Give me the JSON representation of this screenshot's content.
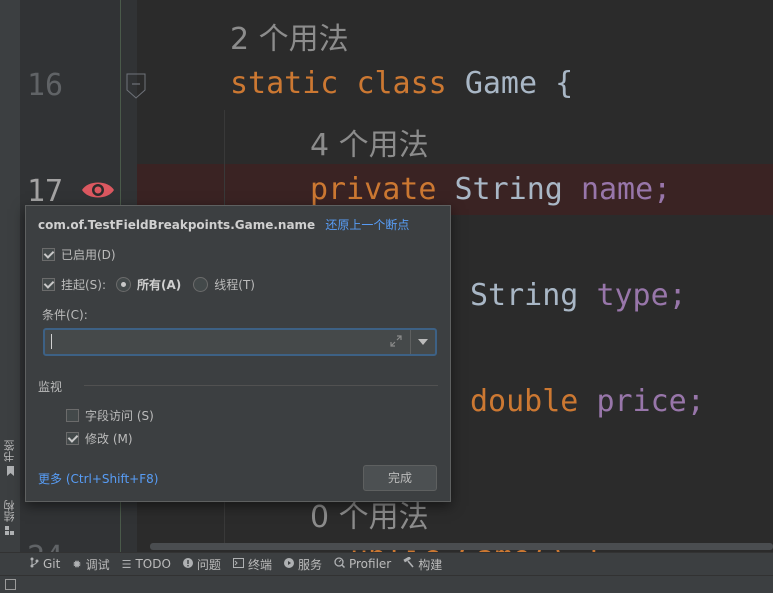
{
  "editor": {
    "usages_1": "2 个用法",
    "usages_2": "4 个用法",
    "usages_3": "0 个用法",
    "line_16": "16",
    "line_17": "17",
    "code_line16_kw1": "static",
    "code_line16_kw2": "class",
    "code_line16_rest": "Game {",
    "code_line17_kw": "private",
    "code_line17_type": "String",
    "code_line17_field": "name;",
    "code_line19_type": "String",
    "code_line19_field": "type;",
    "code_line21_type": "double",
    "code_line21_field": "price;",
    "code_partial": "ublic Game() {"
  },
  "popup": {
    "title": "com.of.TestFieldBreakpoints.Game.name",
    "restore_link": "还原上一个断点",
    "enabled_label": "已启用(D)",
    "suspend_label": "挂起(S):",
    "all_label": "所有(A)",
    "thread_label": "线程(T)",
    "condition_label": "条件(C):",
    "condition_value": "",
    "watch_label": "监视",
    "field_access_label": "字段访问 (S)",
    "modify_label": "修改 (M)",
    "more_link": "更多 (Ctrl+Shift+F8)",
    "done_button": "完成",
    "enabled_checked": true,
    "suspend_checked": true,
    "suspend_all_selected": true,
    "field_access_checked": false,
    "modify_checked": true
  },
  "left_toolwindows": {
    "bookmarks": "书签",
    "structure": "结构"
  },
  "statusbar": {
    "items": [
      {
        "label": "Git",
        "icon": "git-branch-icon"
      },
      {
        "label": "调试",
        "icon": "bug-icon"
      },
      {
        "label": "TODO",
        "icon": "list-icon"
      },
      {
        "label": "问题",
        "icon": "info-icon"
      },
      {
        "label": "终端",
        "icon": "terminal-icon"
      },
      {
        "label": "服务",
        "icon": "play-icon"
      },
      {
        "label": "Profiler",
        "icon": "profiler-icon"
      },
      {
        "label": "构建",
        "icon": "hammer-icon"
      }
    ]
  },
  "colors": {
    "keyword": "#cc7832",
    "field": "#9876aa",
    "plain": "#a9b7c6",
    "breakpoint_line": "#3a2323",
    "link": "#589df6"
  }
}
